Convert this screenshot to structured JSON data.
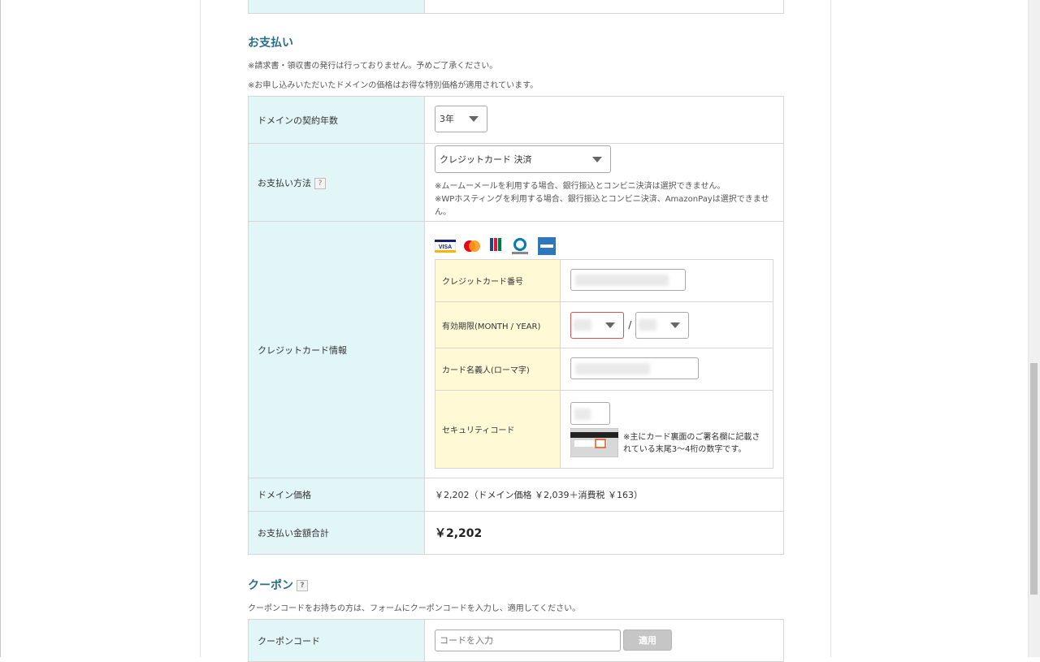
{
  "payment": {
    "title": "お支払い",
    "note1": "※請求書・領収書の発行は行っておりません。予めご了承ください。",
    "note2": "※お申し込みいただいたドメインの価格はお得な特別価格が適用されています。",
    "contract_years_label": "ドメインの契約年数",
    "contract_years_value": "3年",
    "method_label": "お支払い方法",
    "method_help": "?",
    "method_value": "クレジットカード 決済",
    "method_note1": "※ムームーメールを利用する場合、銀行振込とコンビニ決済は選択できません。",
    "method_note2": "※WPホスティングを利用する場合、銀行振込とコンビニ決済、AmazonPayは選択できません。",
    "card_info_label": "クレジットカード情報",
    "card_brands": [
      "visa-icon",
      "mastercard-icon",
      "jcb-icon",
      "diners-club-icon",
      "amex-icon"
    ],
    "card_number_label": "クレジットカード番号",
    "expiry_label": "有効期限(MONTH / YEAR)",
    "expiry_separator": "/",
    "holder_label": "カード名義人(ローマ字)",
    "security_label": "セキュリティコード",
    "security_note": "※主にカード裏面のご署名欄に記載されている末尾3〜4桁の数字です。",
    "domain_price_label": "ドメイン価格",
    "domain_price_value": "￥2,202（ドメイン価格 ￥2,039＋消費税 ￥163）",
    "total_label": "お支払い金額合計",
    "total_value": "￥2,202"
  },
  "coupon": {
    "title": "クーポン",
    "help": "?",
    "note": "クーポンコードをお持ちの方は、フォームにクーポンコードを入力し、適用してください。",
    "code_label": "クーポンコード",
    "code_placeholder": "コードを入力",
    "apply_label": "適用"
  },
  "colors": {
    "label_bg": "#e2f5f7",
    "inner_label_bg": "#fff9d6",
    "title_color": "#2a6f8a",
    "error_border": "#d9534f"
  }
}
